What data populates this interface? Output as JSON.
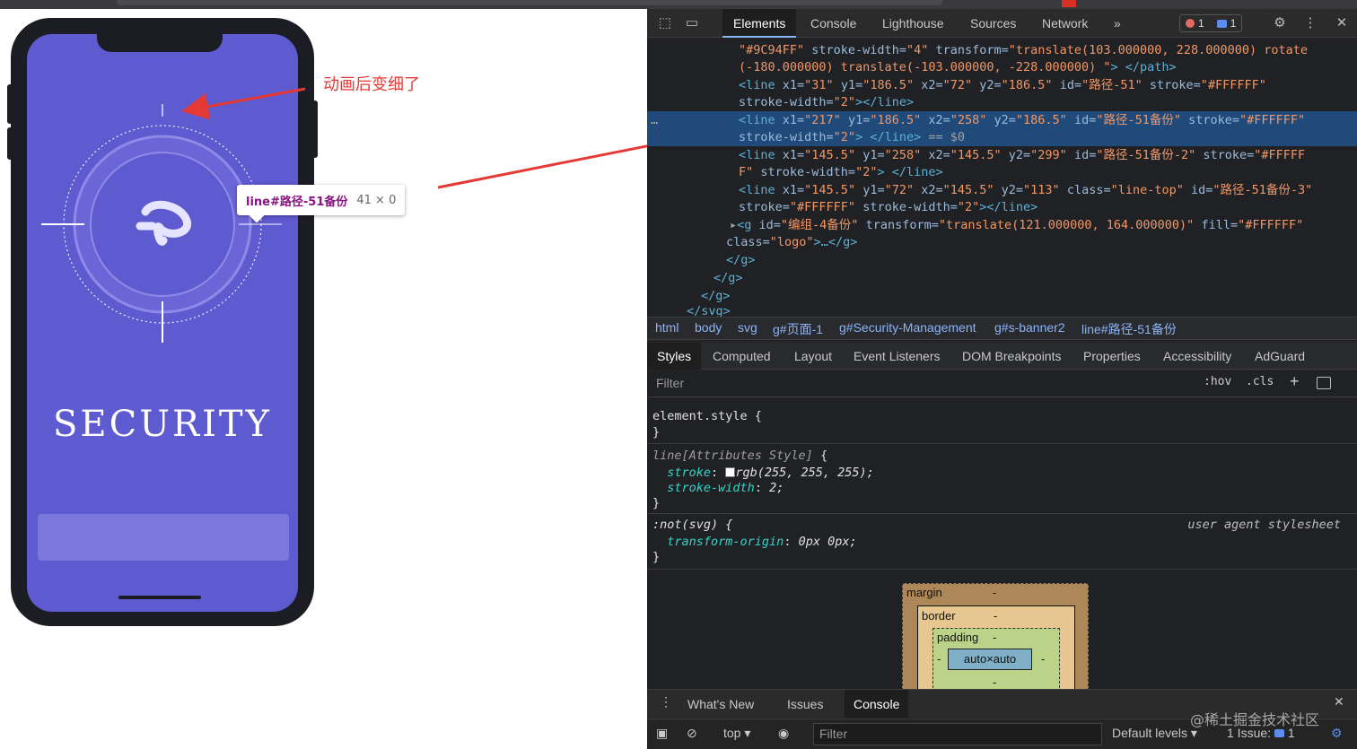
{
  "annotation": {
    "text": "动画后变细了"
  },
  "tooltip": {
    "selector": "line#路径-51备份",
    "size": "41 × 0"
  },
  "app": {
    "title": "SECURITY"
  },
  "devtools": {
    "tabs": [
      "Elements",
      "Console",
      "Lighthouse",
      "Sources",
      "Network"
    ],
    "more_tabs": "»",
    "error_count": "1",
    "message_count": "1",
    "code_lines": [
      {
        "parts": [
          [
            "val",
            "\"#9C94FF\""
          ],
          [
            "attr",
            " stroke-width="
          ],
          [
            "val",
            "\"4\""
          ],
          [
            "attr",
            " transform="
          ],
          [
            "val",
            "\"translate(103.000000, 228.000000) rotate"
          ]
        ]
      },
      {
        "parts": [
          [
            "val",
            "(-180.000000) translate(-103.000000, -228.000000) \""
          ],
          [
            "tag",
            "> </path>"
          ]
        ]
      },
      {
        "parts": [
          [
            "tag",
            "<line "
          ],
          [
            "attr",
            "x1="
          ],
          [
            "val",
            "\"31\""
          ],
          [
            "attr",
            " y1="
          ],
          [
            "val",
            "\"186.5\""
          ],
          [
            "attr",
            " x2="
          ],
          [
            "val",
            "\"72\""
          ],
          [
            "attr",
            " y2="
          ],
          [
            "val",
            "\"186.5\""
          ],
          [
            "attr",
            " id="
          ],
          [
            "val",
            "\"路径-51\""
          ],
          [
            "attr",
            " stroke="
          ],
          [
            "val",
            "\"#FFFFFF\""
          ]
        ]
      },
      {
        "parts": [
          [
            "attr",
            "stroke-width="
          ],
          [
            "val",
            "\"2\""
          ],
          [
            "tag",
            "></line>"
          ]
        ]
      },
      {
        "parts": [
          [
            "tag",
            "<line "
          ],
          [
            "attr",
            "x1="
          ],
          [
            "val",
            "\"217\""
          ],
          [
            "attr",
            " y1="
          ],
          [
            "val",
            "\"186.5\""
          ],
          [
            "attr",
            " x2="
          ],
          [
            "val",
            "\"258\""
          ],
          [
            "attr",
            " y2="
          ],
          [
            "val",
            "\"186.5\""
          ],
          [
            "attr",
            " id="
          ],
          [
            "val",
            "\"路径-51备份\""
          ],
          [
            "attr",
            " stroke="
          ],
          [
            "val",
            "\"#FFFFFF\""
          ]
        ]
      },
      {
        "parts": [
          [
            "attr",
            "stroke-width="
          ],
          [
            "val",
            "\"2\""
          ],
          [
            "tag",
            "> </line>"
          ],
          [
            "grey",
            " == $0"
          ]
        ]
      },
      {
        "parts": [
          [
            "tag",
            "<line "
          ],
          [
            "attr",
            "x1="
          ],
          [
            "val",
            "\"145.5\""
          ],
          [
            "attr",
            " y1="
          ],
          [
            "val",
            "\"258\""
          ],
          [
            "attr",
            " x2="
          ],
          [
            "val",
            "\"145.5\""
          ],
          [
            "attr",
            " y2="
          ],
          [
            "val",
            "\"299\""
          ],
          [
            "attr",
            " id="
          ],
          [
            "val",
            "\"路径-51备份-2\""
          ],
          [
            "attr",
            " stroke="
          ],
          [
            "val",
            "\"#FFFFF"
          ]
        ]
      },
      {
        "parts": [
          [
            "val",
            "F\""
          ],
          [
            "attr",
            " stroke-width="
          ],
          [
            "val",
            "\"2\""
          ],
          [
            "tag",
            "> </line>"
          ]
        ]
      },
      {
        "parts": [
          [
            "tag",
            "<line "
          ],
          [
            "attr",
            "x1="
          ],
          [
            "val",
            "\"145.5\""
          ],
          [
            "attr",
            " y1="
          ],
          [
            "val",
            "\"72\""
          ],
          [
            "attr",
            " x2="
          ],
          [
            "val",
            "\"145.5\""
          ],
          [
            "attr",
            " y2="
          ],
          [
            "val",
            "\"113\""
          ],
          [
            "attr",
            " class="
          ],
          [
            "val",
            "\"line-top\""
          ],
          [
            "attr",
            " id="
          ],
          [
            "val",
            "\"路径-51备份-3\""
          ]
        ]
      },
      {
        "parts": [
          [
            "attr",
            "stroke="
          ],
          [
            "val",
            "\"#FFFFFF\""
          ],
          [
            "attr",
            " stroke-width="
          ],
          [
            "val",
            "\"2\""
          ],
          [
            "tag",
            "></line>"
          ]
        ]
      },
      {
        "parts": [
          [
            "grey",
            "▸"
          ],
          [
            "tag",
            "<g "
          ],
          [
            "attr",
            "id="
          ],
          [
            "val",
            "\"编组-4备份\""
          ],
          [
            "attr",
            " transform="
          ],
          [
            "val",
            "\"translate(121.000000, 164.000000)\""
          ],
          [
            "attr",
            " fill="
          ],
          [
            "val",
            "\"#FFFFFF\""
          ]
        ]
      },
      {
        "parts": [
          [
            "attr",
            "class="
          ],
          [
            "val",
            "\"logo\""
          ],
          [
            "tag",
            ">…</g>"
          ]
        ]
      },
      {
        "parts": [
          [
            "tag",
            "</g>"
          ]
        ]
      },
      {
        "parts": [
          [
            "tag",
            "</g>"
          ]
        ]
      },
      {
        "parts": [
          [
            "tag",
            "</g>"
          ]
        ]
      },
      {
        "parts": [
          [
            "tag",
            "</svg>"
          ]
        ]
      }
    ],
    "selected_dots": "…",
    "breadcrumbs": [
      "html",
      "body",
      "svg",
      "g#页面-1",
      "g#Security-Management",
      "g#s-banner2",
      "line#路径-51备份"
    ],
    "style_tabs": [
      "Styles",
      "Computed",
      "Layout",
      "Event Listeners",
      "DOM Breakpoints",
      "Properties",
      "Accessibility",
      "AdGuard"
    ],
    "filter_placeholder": "Filter",
    "hov": ":hov",
    "cls": ".cls",
    "add": "+",
    "rules": {
      "element_style": "element.style {",
      "close": "}",
      "attr_selector": "line[Attributes Style]",
      "open": " {",
      "stroke_prop": "stroke",
      "stroke_val": "rgb(255, 255, 255);",
      "strokew_prop": "stroke-width",
      "strokew_val": "2;",
      "not_selector": ":not(svg) {",
      "user_agent": "user agent stylesheet",
      "origin_prop": "transform-origin",
      "origin_val": "0px 0px;"
    },
    "box_model": {
      "margin": "margin",
      "border": "border",
      "padding": "padding",
      "content": "auto×auto",
      "dash": "-"
    },
    "drawer_tabs": [
      "What's New",
      "Issues",
      "Console"
    ],
    "console": {
      "context": "top ▾",
      "filter": "Filter",
      "levels": "Default levels ▾",
      "issues": "1 Issue:",
      "issues_count": "1"
    }
  },
  "watermark": "@稀土掘金技术社区",
  "colors": {
    "screen": "#5e5ad0",
    "accent_red": "#e53935",
    "ring": "#9c94ff"
  }
}
